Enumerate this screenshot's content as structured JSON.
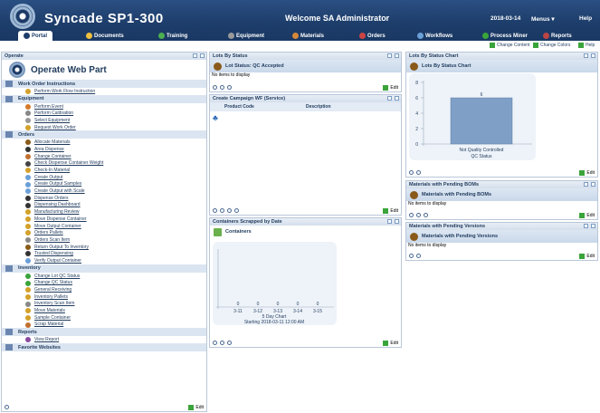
{
  "app": {
    "title": "Syncade SP1-300",
    "welcome": "Welcome SA Administrator",
    "date": "2018-03-14",
    "menus": "Menus",
    "help": "Help"
  },
  "tabs": [
    {
      "label": "Portal",
      "color": "#1d3d6a"
    },
    {
      "label": "Documents",
      "color": "#f0c040"
    },
    {
      "label": "Training",
      "color": "#4caf50"
    },
    {
      "label": "Equipment",
      "color": "#999"
    },
    {
      "label": "Materials",
      "color": "#d4883a"
    },
    {
      "label": "Orders",
      "color": "#c44"
    },
    {
      "label": "Workflows",
      "color": "#6aa0d8"
    },
    {
      "label": "Process Miner",
      "color": "#3aa43a"
    },
    {
      "label": "Reports",
      "color": "#b44"
    }
  ],
  "toolbar": {
    "change_content": "Change Content",
    "change_colors": "Change Colors",
    "help": "Help"
  },
  "operate": {
    "header": "Operate",
    "title": "Operate Web Part",
    "sections": [
      {
        "label": "Work Order Instructions",
        "items": [
          {
            "label": "Perform Work Flow Instruction",
            "color": "#d4a12a"
          }
        ]
      },
      {
        "label": "Equipment",
        "items": [
          {
            "label": "Perform Event",
            "color": "#d47a2a"
          },
          {
            "label": "Perform Calibration",
            "color": "#888"
          },
          {
            "label": "Select Equipment",
            "color": "#999"
          },
          {
            "label": "Request Work Order",
            "color": "#d4a12a"
          }
        ]
      },
      {
        "label": "Orders",
        "items": [
          {
            "label": "Allocate Materials",
            "color": "#8a5a1a"
          },
          {
            "label": "Area Dispense",
            "color": "#333"
          },
          {
            "label": "Change Container",
            "color": "#c07030"
          },
          {
            "label": "Check Dispense Container Weight",
            "color": "#444"
          },
          {
            "label": "Check-In Material",
            "color": "#d4a12a"
          },
          {
            "label": "Create Output",
            "color": "#6aa0d8"
          },
          {
            "label": "Create Output Samples",
            "color": "#6aa0d8"
          },
          {
            "label": "Create Output with Scale",
            "color": "#6aa0d8"
          },
          {
            "label": "Dispense Orders",
            "color": "#333"
          },
          {
            "label": "Dispensing Dashboard",
            "color": "#333"
          },
          {
            "label": "Manufacturing Review",
            "color": "#d4a12a"
          },
          {
            "label": "Move Dispense Container",
            "color": "#d4a12a"
          },
          {
            "label": "Move Output Container",
            "color": "#d4a12a"
          },
          {
            "label": "Orders Pallets",
            "color": "#d4a12a"
          },
          {
            "label": "Orders Scan Item",
            "color": "#888"
          },
          {
            "label": "Return Output To Inventory",
            "color": "#8a5a1a"
          },
          {
            "label": "Trusted Dispensing",
            "color": "#333"
          },
          {
            "label": "Verify Output Container",
            "color": "#6aa0d8"
          }
        ]
      },
      {
        "label": "Inventory",
        "items": [
          {
            "label": "Change Lot QC Status",
            "color": "#3aa43a"
          },
          {
            "label": "Change QC Status",
            "color": "#3aa43a"
          },
          {
            "label": "General Receiving",
            "color": "#d4a12a"
          },
          {
            "label": "Inventory Pallets",
            "color": "#d4a12a"
          },
          {
            "label": "Inventory Scan Item",
            "color": "#888"
          },
          {
            "label": "Move Materials",
            "color": "#d4a12a"
          },
          {
            "label": "Sample Container",
            "color": "#d4a12a"
          },
          {
            "label": "Scrap Material",
            "color": "#c07030"
          }
        ]
      },
      {
        "label": "Reports",
        "items": [
          {
            "label": "View Report",
            "color": "#8a4aa0"
          }
        ]
      },
      {
        "label": "Favorite Websites",
        "items": []
      }
    ],
    "edit": "Edit"
  },
  "lots_status": {
    "header": "Lots By Status",
    "title": "Lot Status: QC Accepted",
    "empty": "No items to display",
    "edit": "Edit"
  },
  "campaign": {
    "header": "Create Campaign WF (Service)",
    "columns": [
      "Product Code",
      "Description"
    ],
    "edit": "Edit"
  },
  "containers": {
    "header": "Containers Scrapped by Date",
    "title": "Containers",
    "caption": "5 Day Chart",
    "caption2": "Starting 2018-03-11 12:00 AM",
    "edit": "Edit"
  },
  "lots_chart": {
    "header": "Lots By Status Chart",
    "title": "Lots By Status Chart",
    "edit": "Edit"
  },
  "boms": {
    "header": "Materials with Pending BOMs",
    "title": "Materials with Pending BOMs",
    "empty": "No items to display",
    "edit": "Edit"
  },
  "versions": {
    "header": "Materials with Pending Versions",
    "title": "Materials with Pending Versions",
    "empty": "No items to display",
    "edit": "Edit"
  },
  "chart_data": [
    {
      "type": "bar",
      "categories": [
        "Not Quality Controlled"
      ],
      "values": [
        6
      ],
      "xlabel": "QC Status",
      "ylim": [
        0,
        8
      ],
      "yticks": [
        0,
        2,
        4,
        6,
        8
      ]
    },
    {
      "type": "bar",
      "categories": [
        "3-11",
        "3-12",
        "3-13",
        "3-14",
        "3-15"
      ],
      "values": [
        0,
        0,
        0,
        0,
        0
      ]
    }
  ]
}
